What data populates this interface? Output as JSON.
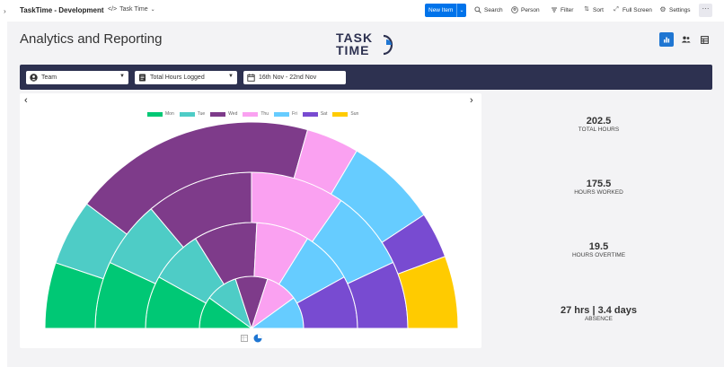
{
  "topbar": {
    "app_title": "TaskTime - Development",
    "view_name": "Task Time",
    "new_item": "New Item",
    "search": "Search",
    "person": "Person",
    "filter": "Filter",
    "sort": "Sort",
    "full_screen": "Full Screen",
    "settings": "Settings",
    "more": "···"
  },
  "page": {
    "title": "Analytics and Reporting",
    "logo_line1": "TASK",
    "logo_line2": "TIME"
  },
  "filters": {
    "group": "Team",
    "metric": "Total Hours Logged",
    "date_range": "16th Nov - 22nd Nov"
  },
  "colors": {
    "Mon": "#00c875",
    "Tue": "#4eccc6",
    "Wed": "#7e3b8a",
    "Thu": "#faa1f1",
    "Fri": "#66ccff",
    "Sat": "#784bd1",
    "Sun": "#ffcb00",
    "accent": "#1f76d2",
    "navy": "#2d3150"
  },
  "chart_data": {
    "type": "sunburst-semicircle",
    "legend": [
      "Mon",
      "Tue",
      "Wed",
      "Thu",
      "Fri",
      "Sat",
      "Sun"
    ],
    "rings": [
      {
        "segments": [
          [
            "Mon",
            1
          ],
          [
            "Tue",
            1
          ],
          [
            "Wed",
            1
          ],
          [
            "Thu",
            1
          ],
          [
            "Fri",
            1
          ]
        ]
      },
      {
        "segments": [
          [
            "Mon",
            1
          ],
          [
            "Tue",
            1
          ],
          [
            "Wed",
            1.2
          ],
          [
            "Thu",
            1
          ],
          [
            "Fri",
            1
          ],
          [
            "Sat",
            1
          ]
        ]
      },
      {
        "segments": [
          [
            "Mon",
            1
          ],
          [
            "Tue",
            1
          ],
          [
            "Wed",
            1.6
          ],
          [
            "Thu",
            1.4
          ],
          [
            "Fri",
            1.2
          ],
          [
            "Sat",
            1
          ]
        ]
      },
      {
        "segments": [
          [
            "Mon",
            1
          ],
          [
            "Tue",
            1
          ],
          [
            "Wed",
            3.7
          ],
          [
            "Thu",
            0.8
          ],
          [
            "Fri",
            1.4
          ],
          [
            "Sat",
            0.7
          ],
          [
            "Sun",
            1.1
          ]
        ]
      }
    ]
  },
  "stats": [
    {
      "value": "202.5",
      "label": "TOTAL HOURS"
    },
    {
      "value": "175.5",
      "label": "HOURS WORKED"
    },
    {
      "value": "19.5",
      "label": "HOURS OVERTIME"
    },
    {
      "value": "27 hrs | 3.4 days",
      "label": "ABSENCE"
    }
  ]
}
